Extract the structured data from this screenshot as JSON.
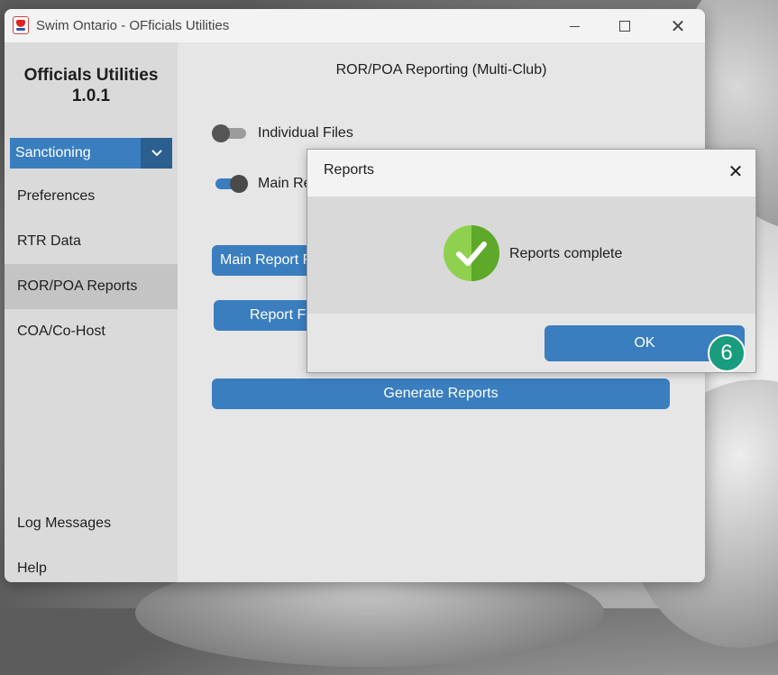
{
  "window": {
    "title": "Swim Ontario - OFficials Utilities",
    "icon": "swim-ontario-logo-icon",
    "controls": [
      "minimize-icon",
      "maximize-icon",
      "close-icon"
    ]
  },
  "sidebar": {
    "app_title_line1": "Officials Utilities",
    "app_title_line2": "1.0.1",
    "dropdown": {
      "selected": "Sanctioning",
      "icon": "chevron-down-icon"
    },
    "items": [
      {
        "label": "Preferences"
      },
      {
        "label": "RTR Data"
      },
      {
        "label": "ROR/POA Reports",
        "active": true
      },
      {
        "label": "COA/Co-Host"
      }
    ],
    "bottom_items": [
      {
        "label": "Log Messages"
      },
      {
        "label": "Help"
      }
    ]
  },
  "main": {
    "heading": "ROR/POA Reporting (Multi-Club)",
    "toggles": [
      {
        "label": "Individual Files",
        "on": false
      },
      {
        "label": "Main Re",
        "on": true
      }
    ],
    "main_report_button": "Main Report F",
    "report_folder_button": "Report Fo",
    "generate_button": "Generate Reports"
  },
  "dialog": {
    "title": "Reports",
    "close_icon": "close-icon",
    "message": "Reports complete",
    "status_icon": "success-check-icon",
    "ok_button": "OK"
  },
  "step_badge": "6",
  "colors": {
    "accent": "#3a7ebf",
    "accent_dark": "#2a5f8f",
    "badge": "#1a9c7e",
    "success_green": "#7ac943"
  }
}
